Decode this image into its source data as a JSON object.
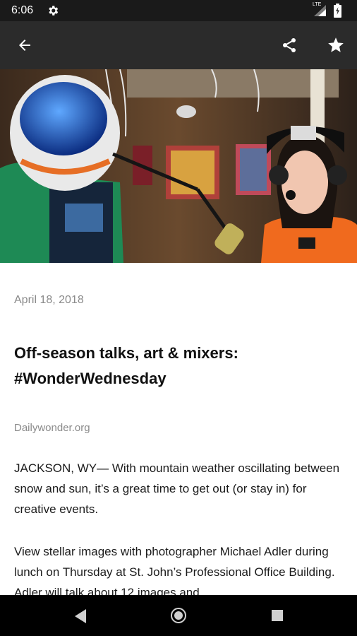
{
  "status_bar": {
    "time": "6:06",
    "network": "LTE",
    "icons": [
      "gear-icon",
      "signal-icon",
      "battery-icon"
    ]
  },
  "app_bar": {
    "icons": [
      "back-arrow-icon",
      "share-icon",
      "star-icon"
    ]
  },
  "article": {
    "date": "April 18, 2018",
    "title": "Off-season talks, art & mixers: #WonderWednesday",
    "source": "Dailywonder.org",
    "paragraphs": [
      "JACKSON, WY— With mountain weather oscillating between snow and sun, it’s a great time to get out (or stay in) for creative events.",
      "View stellar images with photographer Michael Adler during lunch on Thursday at St. John’s Professional Office Building. Adler will talk about 12 images and"
    ]
  },
  "nav_bar": {
    "icons": [
      "nav-back-icon",
      "nav-home-icon",
      "nav-recents-icon"
    ]
  },
  "colors": {
    "status_bar": "#1a1a1a",
    "app_bar": "#2b2b2b",
    "nav_bar": "#000000",
    "muted_text": "#8a8a8a"
  }
}
